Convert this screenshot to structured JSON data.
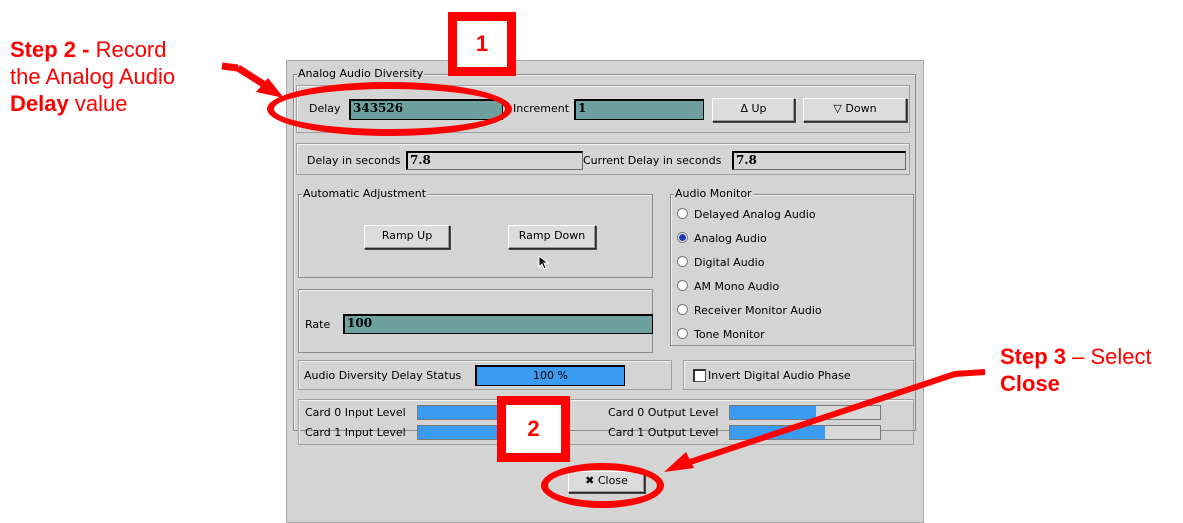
{
  "annotations": {
    "step2": {
      "bold": "Step 2 - ",
      "line1_rest": "Record",
      "line2": "the Analog Audio",
      "bold2": "Delay",
      "line3_rest": " value"
    },
    "step3": {
      "bold": "Step 3",
      "rest": " – Select",
      "bold2": "Close"
    },
    "box1": "1",
    "box2": "2",
    "color": "#ff0000"
  },
  "dialog": {
    "group_title": "Analog Audio Diversity",
    "delay_label": "Delay",
    "delay_value": "343526",
    "increment_label": "Increment",
    "increment_value": "1",
    "up_label": "Up",
    "down_label": "Down",
    "delay_seconds_label": "Delay in seconds",
    "delay_seconds_value": "7.8",
    "current_delay_label": "Current Delay in seconds",
    "current_delay_value": "7.8",
    "auto_adjust_title": "Automatic Adjustment",
    "ramp_up_label": "Ramp Up",
    "ramp_down_label": "Ramp Down",
    "rate_label": "Rate",
    "rate_value": "100",
    "audio_monitor_title": "Audio Monitor",
    "audio_monitor_options": [
      {
        "label": "Delayed Analog  Audio",
        "checked": false
      },
      {
        "label": "Analog Audio",
        "checked": true
      },
      {
        "label": "Digital Audio",
        "checked": false
      },
      {
        "label": "AM Mono Audio",
        "checked": false
      },
      {
        "label": "Receiver Monitor Audio",
        "checked": false
      },
      {
        "label": "Tone Monitor",
        "checked": false
      }
    ],
    "delay_status_label": "Audio Diversity Delay Status",
    "delay_status_value": "100 %",
    "invert_phase_label": "Invert Digital Audio Phase",
    "invert_phase_checked": false,
    "levels": [
      {
        "label": "Card 0 Input Level",
        "level": 0.55
      },
      {
        "label": "Card 1 Input Level",
        "level": 0.55
      },
      {
        "label": "Card 0 Output Level",
        "level": 0.57
      },
      {
        "label": "Card 1 Output Level",
        "level": 0.63
      }
    ],
    "close_label": "Close",
    "accent_color": "#3b9bf0",
    "field_color": "#6fa0a0"
  }
}
